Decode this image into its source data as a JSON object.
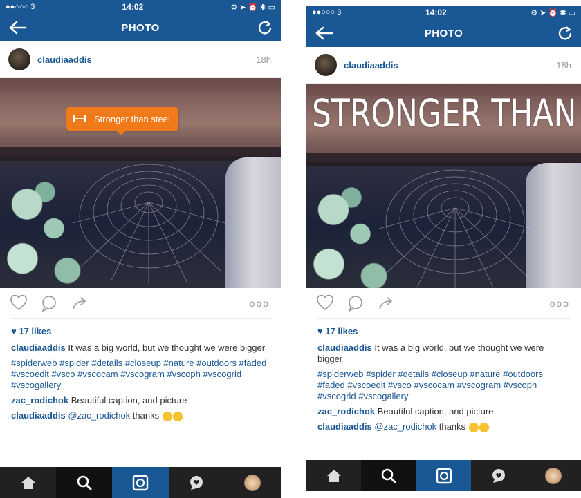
{
  "status": {
    "carrier": "●●○○○ 3",
    "time": "14:02"
  },
  "nav": {
    "title": "PHOTO"
  },
  "post": {
    "username": "claudiaaddis",
    "time_ago": "18h",
    "tag_label": "Stronger than steel",
    "overlay_text": "STRONGER THAN STEEL",
    "likes": "17 likes",
    "caption_text": "It was a big world, but we thought we were bigger",
    "hashtags": "#spiderweb #spider #details #closeup #nature #outdoors #faded #vscoedit #vsco #vscocam #vscogram #vscoph #vscogrid #vscogallery",
    "comments": [
      {
        "user": "zac_rodichok",
        "text": "Beautiful caption, and picture"
      },
      {
        "user": "claudiaaddis",
        "mention": "@zac_rodichok",
        "text": "thanks"
      }
    ],
    "more": "ooo"
  },
  "colors": {
    "brand": "#1a5795",
    "tag": "#f07a1a"
  },
  "icons": [
    "back-arrow-icon",
    "refresh-icon",
    "heart-icon",
    "comment-icon",
    "share-icon",
    "home-icon",
    "search-icon",
    "camera-icon",
    "activity-icon",
    "profile-icon"
  ]
}
